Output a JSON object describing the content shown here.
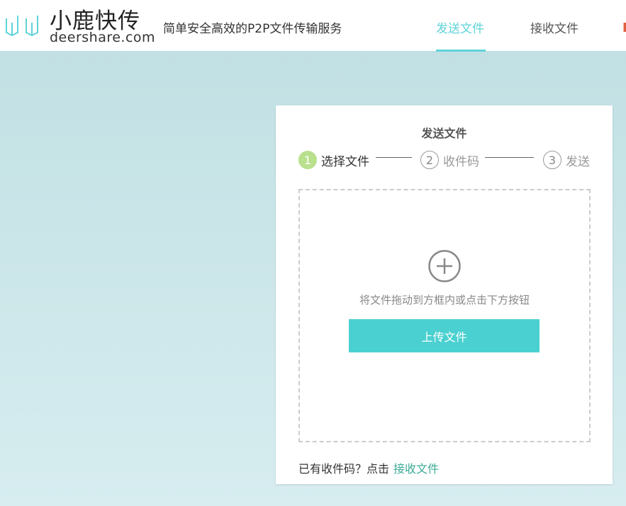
{
  "header": {
    "logo_cn": "小鹿快传",
    "logo_en": "deershare.com",
    "slogan": "简单安全高效的P2P文件传输服务",
    "nav": [
      {
        "label": "发送文件",
        "active": true
      },
      {
        "label": "接收文件",
        "active": false
      }
    ]
  },
  "colors": {
    "accent": "#5fd3d9",
    "button": "#4ad0d0",
    "link": "#3aaa96",
    "step_done": "#b9e08d"
  },
  "card": {
    "title": "发送文件",
    "steps": [
      {
        "num": "1",
        "label": "选择文件"
      },
      {
        "num": "2",
        "label": "收件码"
      },
      {
        "num": "3",
        "label": "发送"
      }
    ],
    "current_step": 1,
    "drop_hint": "将文件拖动到方框内或点击下方按钮",
    "upload_label": "上传文件",
    "footer_text": "已有收件码？点击",
    "footer_link": "接收文件"
  }
}
